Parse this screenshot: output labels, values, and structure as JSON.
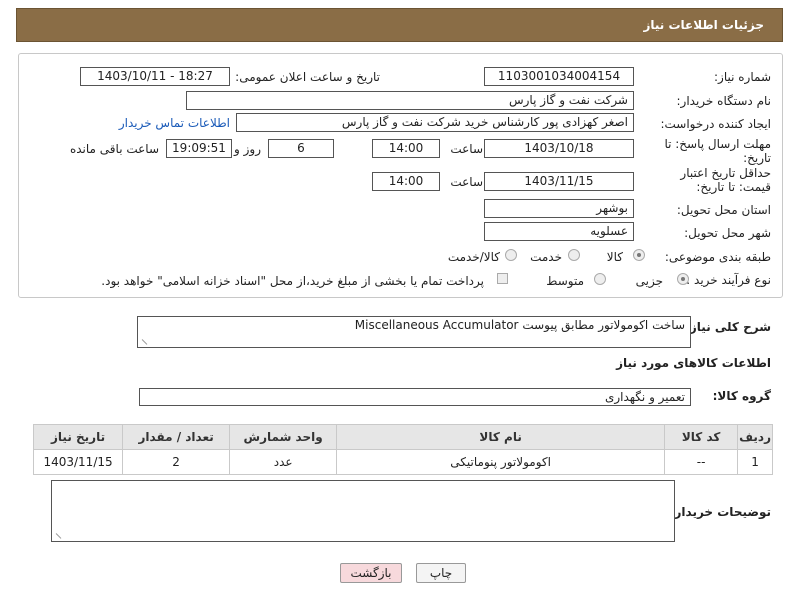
{
  "header": {
    "title": "جزئیات اطلاعات نیاز"
  },
  "form": {
    "need_number_label": "شماره نیاز:",
    "need_number": "1103001034004154",
    "announce_label": "تاریخ و ساعت اعلان عمومی:",
    "announce_value": "1403/10/11 - 18:27",
    "buyer_org_label": "نام دستگاه خریدار:",
    "buyer_org": "شرکت نفت و گاز پارس",
    "creator_label": "ایجاد کننده درخواست:",
    "creator": "اصغر کهزادی پور کارشناس خرید شرکت نفت و گاز پارس",
    "contact_link": "اطلاعات تماس خریدار",
    "reply_deadline_label": "مهلت ارسال پاسخ: تا تاریخ:",
    "reply_date": "1403/10/18",
    "time_label": "ساعت",
    "reply_time": "14:00",
    "days": "6",
    "days_label": "روز و",
    "remaining_time": "19:09:51",
    "remaining_label": "ساعت باقی مانده",
    "price_validity_label": "حداقل تاریخ اعتبار قیمت: تا تاریخ:",
    "price_date": "1403/11/15",
    "price_time": "14:00",
    "province_label": "استان محل تحویل:",
    "province": "بوشهر",
    "city_label": "شهر محل تحویل:",
    "city": "عسلویه",
    "category_label": "طبقه بندی موضوعی:",
    "category_options": [
      "کالا",
      "خدمت",
      "کالا/خدمت"
    ],
    "process_label": "نوع فرآیند خرید :",
    "process_options": [
      "جزیی",
      "متوسط"
    ],
    "payment_note": "پرداخت تمام یا بخشی از مبلغ خرید،از محل \"اسناد خزانه اسلامی\" خواهد بود."
  },
  "description": {
    "label": "شرح کلی نیاز:",
    "value": "ساخت اکومولاتور مطابق پیوست Miscellaneous Accumulator"
  },
  "goods_info_title": "اطلاعات کالاهای مورد نیاز",
  "goods_group": {
    "label": "گروه کالا:",
    "value": "تعمیر و نگهداری"
  },
  "table": {
    "headers": [
      "ردیف",
      "کد کالا",
      "نام کالا",
      "واحد شمارش",
      "تعداد / مقدار",
      "تاریخ نیاز"
    ],
    "rows": [
      [
        "1",
        "--",
        "اکومولاتور پنوماتیکی",
        "عدد",
        "2",
        "1403/11/15"
      ]
    ]
  },
  "buyer_notes_label": "توضیحات خریدار:",
  "buttons": {
    "print": "چاپ",
    "back": "بازگشت"
  },
  "colors": {
    "header_bg": "#8a6d46",
    "link": "#1a5ab8",
    "back_btn_bg": "#f7d9dc"
  }
}
